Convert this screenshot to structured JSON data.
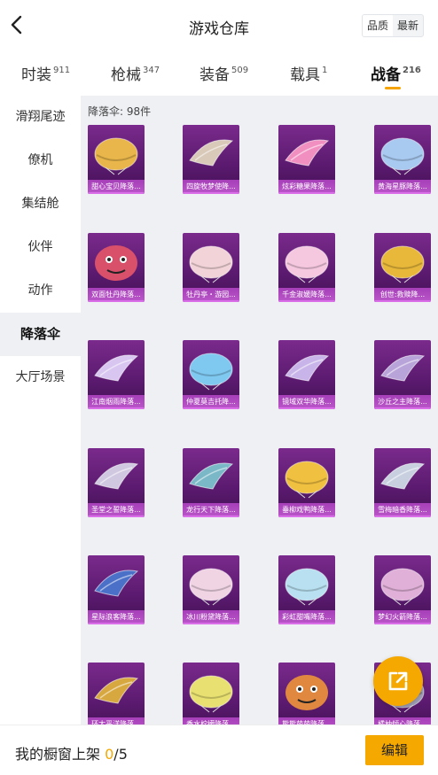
{
  "header": {
    "title": "游戏仓库",
    "sort_options": [
      "品质",
      "最新"
    ],
    "sort_selected": "品质"
  },
  "tabs": [
    {
      "label": "时装",
      "count": "911"
    },
    {
      "label": "枪械",
      "count": "347"
    },
    {
      "label": "装备",
      "count": "509"
    },
    {
      "label": "载具",
      "count": "1"
    },
    {
      "label": "战备",
      "count": "216"
    }
  ],
  "active_tab": "战备",
  "sidebar": {
    "items": [
      "滑翔尾迹",
      "僚机",
      "集结舱",
      "伙伴",
      "动作",
      "降落伞",
      "大厅场景"
    ],
    "active": "降落伞"
  },
  "content": {
    "count_label": "降落伞: 98件",
    "items": [
      {
        "name": "甜心宝贝降落...",
        "color": "#e8b64a",
        "icon": "canopy-dark-red"
      },
      {
        "name": "四旋牧梦使降...",
        "color": "#d9c9b8",
        "icon": "canopy-candy-wrap"
      },
      {
        "name": "炫彩糖果降落...",
        "color": "#f08fc0",
        "icon": "canopy-pink-feather"
      },
      {
        "name": "黄海星豚降落...",
        "color": "#a8c9f0",
        "icon": "canopy-pastel-cloud"
      },
      {
        "name": "双面牡丹降落...",
        "color": "#d8506a",
        "icon": "canopy-monster-face"
      },
      {
        "name": "牡丹亭・游园...",
        "color": "#f2d4d8",
        "icon": "canopy-round-pink"
      },
      {
        "name": "千金淑媛降落...",
        "color": "#f6c8e0",
        "icon": "canopy-bow"
      },
      {
        "name": "创世:救赎降...",
        "color": "#e8b83a",
        "icon": "canopy-gold-dome"
      },
      {
        "name": "江南烟雨降落...",
        "color": "#d8c6f0",
        "icon": "canopy-lavender-wing"
      },
      {
        "name": "仲夏莫吉托降...",
        "color": "#7fc8f0",
        "icon": "canopy-blue-swirl"
      },
      {
        "name": "镜域双华降落...",
        "color": "#c8b4e8",
        "icon": "canopy-violet-wing"
      },
      {
        "name": "沙丘之主降落...",
        "color": "#b8a4d8",
        "icon": "canopy-purple-blade"
      },
      {
        "name": "圣堂之誓降落...",
        "color": "#d0c8e0",
        "icon": "canopy-silver-blade"
      },
      {
        "name": "龙行天下降落...",
        "color": "#7ab8c8",
        "icon": "canopy-dragon"
      },
      {
        "name": "垂柳戏鸭降落...",
        "color": "#f0c040",
        "icon": "canopy-yellow-dome"
      },
      {
        "name": "雪梅暗香降落...",
        "color": "#c8d0e0",
        "icon": "canopy-steel-wing"
      },
      {
        "name": "星际浪客降落...",
        "color": "#4a70c8",
        "icon": "canopy-blue-wing"
      },
      {
        "name": "冰川粉黛降落...",
        "color": "#f0d4e4",
        "icon": "canopy-pink-lace"
      },
      {
        "name": "彩虹甜嘴降落...",
        "color": "#b8e0f0",
        "icon": "canopy-pastel-stripe"
      },
      {
        "name": "梦幻火箭降落...",
        "color": "#e0b0d8",
        "icon": "canopy-confetti"
      },
      {
        "name": "环太平洋降落...",
        "color": "#d8a840",
        "icon": "canopy-gold-mech"
      },
      {
        "name": "香水柠檬降落...",
        "color": "#e8e070",
        "icon": "canopy-lemon"
      },
      {
        "name": "熊熊萌萌降落...",
        "color": "#e08840",
        "icon": "canopy-red-panda"
      },
      {
        "name": "橘柚倾心降落...",
        "color": "#a0a0b8",
        "icon": "canopy-hidden"
      }
    ]
  },
  "footer": {
    "label": "我的橱窗上架",
    "current": "0",
    "total": "/5",
    "edit_label": "编辑"
  },
  "colors": {
    "accent": "#f5a800",
    "card_bg": "#5a1a6e",
    "card_label": "#b854c7"
  },
  "icons": {
    "back": "chevron-left-icon",
    "share": "share-external-icon"
  }
}
